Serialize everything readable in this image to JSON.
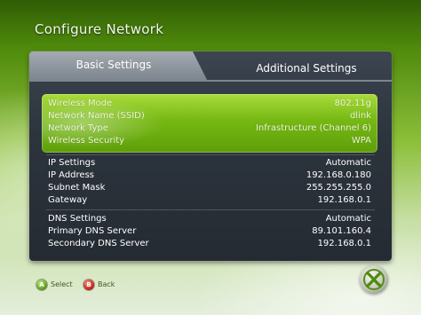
{
  "header": {
    "title": "Configure Network"
  },
  "tabs": [
    {
      "label": "Basic Settings",
      "active": true
    },
    {
      "label": "Additional Settings",
      "active": false
    }
  ],
  "wireless": {
    "rows": [
      {
        "label": "Wireless Mode",
        "value": "802.11g"
      },
      {
        "label": "Network Name (SSID)",
        "value": "dlink"
      },
      {
        "label": "Network Type",
        "value": "Infrastructure (Channel 6)"
      },
      {
        "label": "Wireless Security",
        "value": "WPA"
      }
    ]
  },
  "ip": {
    "rows": [
      {
        "label": "IP Settings",
        "value": "Automatic"
      },
      {
        "label": "IP Address",
        "value": "192.168.0.180"
      },
      {
        "label": "Subnet Mask",
        "value": "255.255.255.0"
      },
      {
        "label": "Gateway",
        "value": "192.168.0.1"
      }
    ]
  },
  "dns": {
    "rows": [
      {
        "label": "DNS Settings",
        "value": "Automatic"
      },
      {
        "label": "Primary DNS Server",
        "value": "89.101.160.4"
      },
      {
        "label": "Secondary DNS Server",
        "value": "192.168.0.1"
      }
    ]
  },
  "footer": {
    "select_label": "Select",
    "back_label": "Back",
    "select_button_glyph": "A",
    "back_button_glyph": "B"
  },
  "colors": {
    "highlight": "#76b813",
    "panel": "#2c343d",
    "a_button": "#5d9c17",
    "b_button": "#c0231a"
  },
  "icons": {
    "a_button": "a-button-icon",
    "b_button": "b-button-icon",
    "logo": "xbox-logo-icon"
  }
}
